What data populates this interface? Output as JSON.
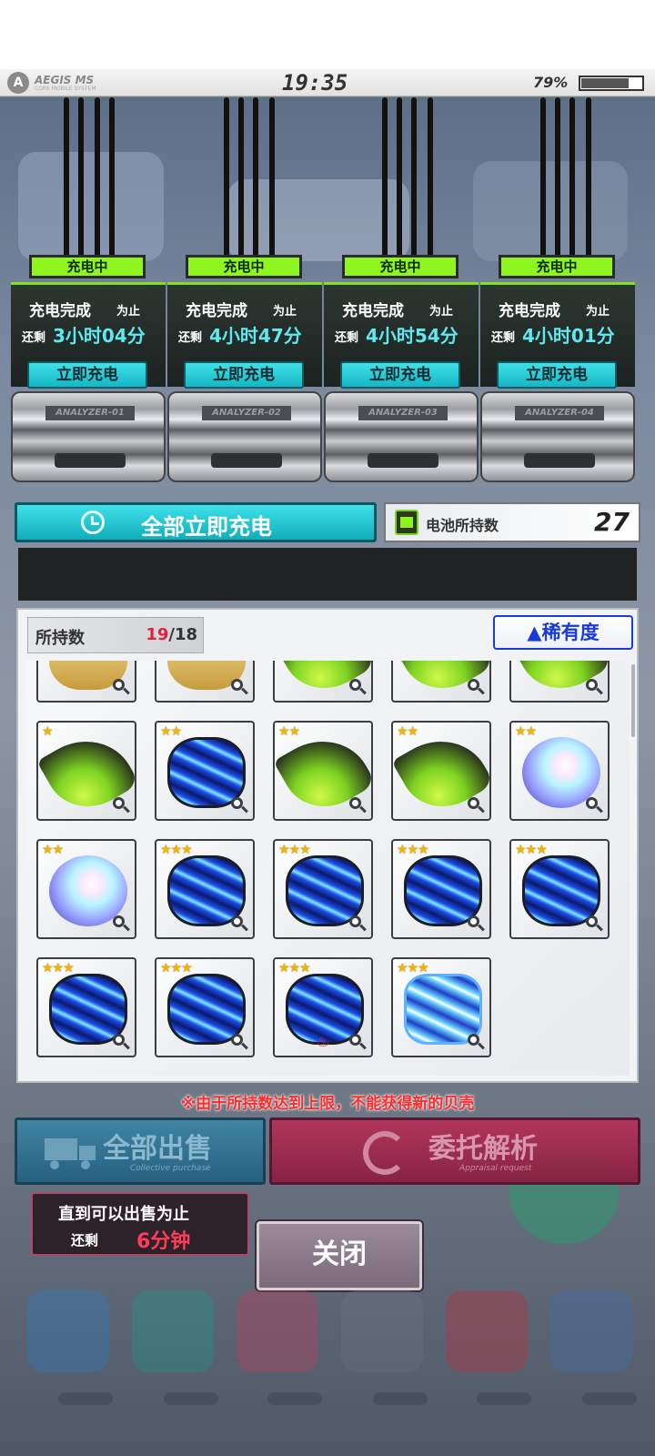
{
  "status_bar": {
    "brand": "AEGIS MS",
    "brand_sub": "CORE MOBILE SYSTEM",
    "time": "19:35",
    "battery_percent": "79%",
    "battery_level": 0.79
  },
  "chargers": [
    {
      "status": "充电中",
      "line1": "充电完成",
      "suffix": "为止",
      "remain_label": "还剩",
      "time": "3小时04分",
      "button": "立即充电",
      "analyzer": "ANALYZER-01"
    },
    {
      "status": "充电中",
      "line1": "充电完成",
      "suffix": "为止",
      "remain_label": "还剩",
      "time": "4小时47分",
      "button": "立即充电",
      "analyzer": "ANALYZER-02"
    },
    {
      "status": "充电中",
      "line1": "充电完成",
      "suffix": "为止",
      "remain_label": "还剩",
      "time": "4小时54分",
      "button": "立即充电",
      "analyzer": "ANALYZER-03"
    },
    {
      "status": "充电中",
      "line1": "充电完成",
      "suffix": "为止",
      "remain_label": "还剩",
      "time": "4小时01分",
      "button": "立即充电",
      "analyzer": "ANALYZER-04"
    }
  ],
  "charge_all": {
    "label": "全部立即充电",
    "icon": "clock-icon"
  },
  "battery": {
    "label": "电池所持数",
    "count": "27",
    "icon": "battery-icon"
  },
  "inventory": {
    "owned_label": "所持数",
    "owned_current": "19",
    "owned_max": "/18",
    "sort_button": "▲稀有度",
    "shells": [
      {
        "kind": "gold",
        "stars": ""
      },
      {
        "kind": "gold",
        "stars": ""
      },
      {
        "kind": "conch",
        "stars": ""
      },
      {
        "kind": "conch",
        "stars": ""
      },
      {
        "kind": "conch",
        "stars": ""
      },
      {
        "kind": "conch",
        "stars": "★"
      },
      {
        "kind": "clam",
        "stars": "★★"
      },
      {
        "kind": "conch",
        "stars": "★★"
      },
      {
        "kind": "conch",
        "stars": "★★"
      },
      {
        "kind": "nautilus",
        "stars": "★★"
      },
      {
        "kind": "nautilus",
        "stars": "★★"
      },
      {
        "kind": "clam",
        "stars": "★★★"
      },
      {
        "kind": "clam",
        "stars": "★★★"
      },
      {
        "kind": "clam",
        "stars": "★★★"
      },
      {
        "kind": "clam",
        "stars": "★★★"
      },
      {
        "kind": "clam",
        "stars": "★★★"
      },
      {
        "kind": "clam",
        "stars": "★★★"
      },
      {
        "kind": "clam",
        "stars": "★★★",
        "marked": true
      },
      {
        "kind": "clam-big",
        "stars": "★★★"
      }
    ]
  },
  "warning": "※由于所持数达到上限，不能获得新的贝壳",
  "actions": {
    "sell_all": "全部出售",
    "sell_all_sub": "Collective purchase",
    "delegate": "委托解析",
    "delegate_sub": "Appraisal request",
    "close": "关闭"
  },
  "sell_timer": {
    "line1": "直到可以出售为止",
    "remain": "还剩",
    "value": "6分钟"
  },
  "colors": {
    "charging_green": "#8ef51e",
    "cyan_button": "#14b7c4",
    "owned_over": "#e0203c",
    "warning_red": "#ff2a2a",
    "rarity_blue": "#1b3bd8",
    "star_gold": "#f5b400"
  }
}
